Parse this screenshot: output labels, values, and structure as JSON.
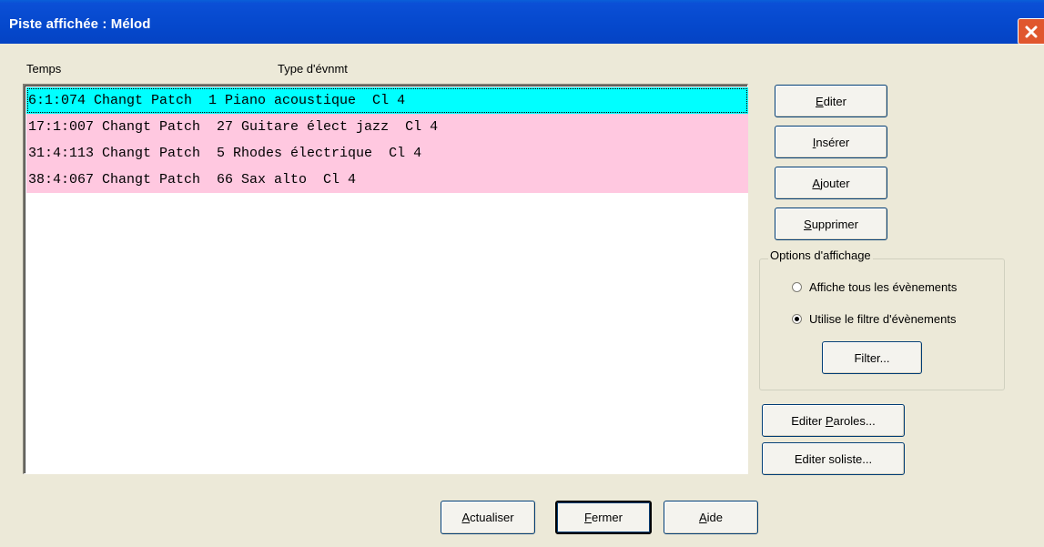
{
  "window": {
    "title": "Piste affichée : Mélod",
    "close_icon": "close-x-icon"
  },
  "list": {
    "columns": [
      "Temps",
      "Type d'évnmt"
    ],
    "rows": [
      "6:1:074 Changt Patch  1 Piano acoustique  Cl 4",
      "17:1:007 Changt Patch  27 Guitare élect jazz  Cl 4",
      "31:4:113 Changt Patch  5 Rhodes électrique  Cl 4",
      "38:4:067 Changt Patch  66 Sax alto  Cl 4"
    ],
    "selected_index": 0
  },
  "buttons": {
    "edit": {
      "pre": "",
      "key": "E",
      "post": "diter"
    },
    "insert": {
      "pre": "",
      "key": "I",
      "post": "nsérer"
    },
    "add": {
      "pre": "",
      "key": "A",
      "post": "jouter"
    },
    "delete": {
      "pre": "",
      "key": "S",
      "post": "upprimer"
    },
    "filter": "Filter...",
    "edit_lyrics": {
      "pre": "Editer ",
      "key": "P",
      "post": "aroles..."
    },
    "edit_soloist": "Editer soliste...",
    "refresh": {
      "pre": "",
      "key": "A",
      "post": "ctualiser"
    },
    "close": {
      "pre": "",
      "key": "F",
      "post": "ermer"
    },
    "help": {
      "pre": "",
      "key": "A",
      "post": "ide"
    }
  },
  "display_options": {
    "legend": "Options d'affichage",
    "show_all": "Affiche tous les évènements",
    "use_filter": "Utilise le filtre d'évènements",
    "selected": "use_filter"
  },
  "colors": {
    "selected_row": "#00ffff",
    "row": "#ffc8e0",
    "titlebar": "#0548cc",
    "dialog": "#ece9d8"
  }
}
